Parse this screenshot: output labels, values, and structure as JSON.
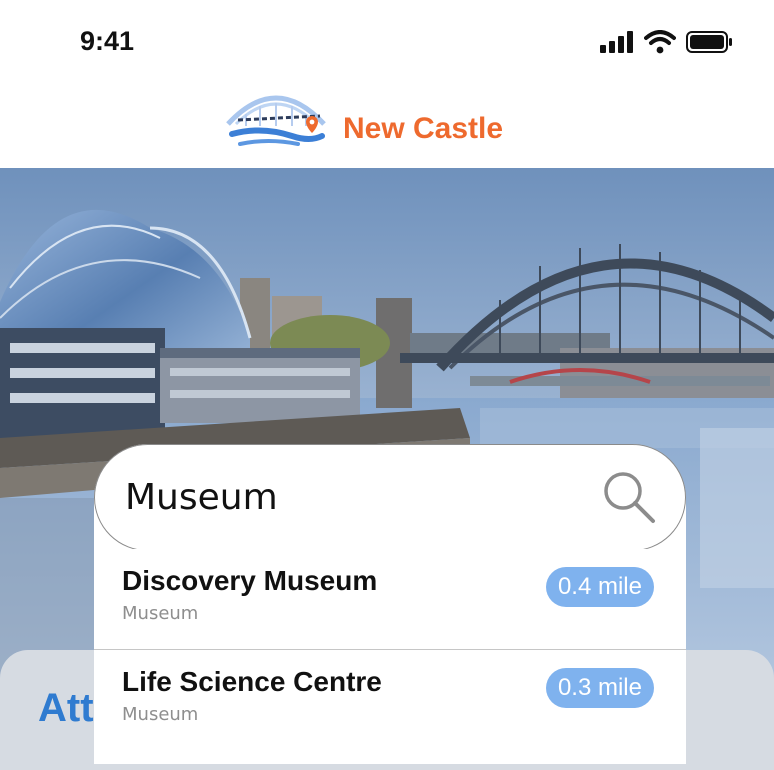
{
  "status_bar": {
    "time": "9:41",
    "icons": [
      "signal-icon",
      "wifi-icon",
      "battery-icon"
    ]
  },
  "brand": {
    "name": "New Castle",
    "color": "#ee6a2e",
    "logo_icon": "tyne-bridge-logo"
  },
  "hero": {
    "image": "newcastle-quayside-photo"
  },
  "search": {
    "value": "Museum",
    "icon": "search-icon"
  },
  "results": [
    {
      "name": "Discovery Museum",
      "category": "Museum",
      "distance": "0.4 mile"
    },
    {
      "name": "Life Science Centre",
      "category": "Museum",
      "distance": "0.3 mile"
    }
  ],
  "attractions": {
    "title": "Attractions"
  },
  "colors": {
    "accent": "#ee6a2e",
    "badge": "#7fb2ee",
    "title_blue": "#2f7bd0"
  }
}
